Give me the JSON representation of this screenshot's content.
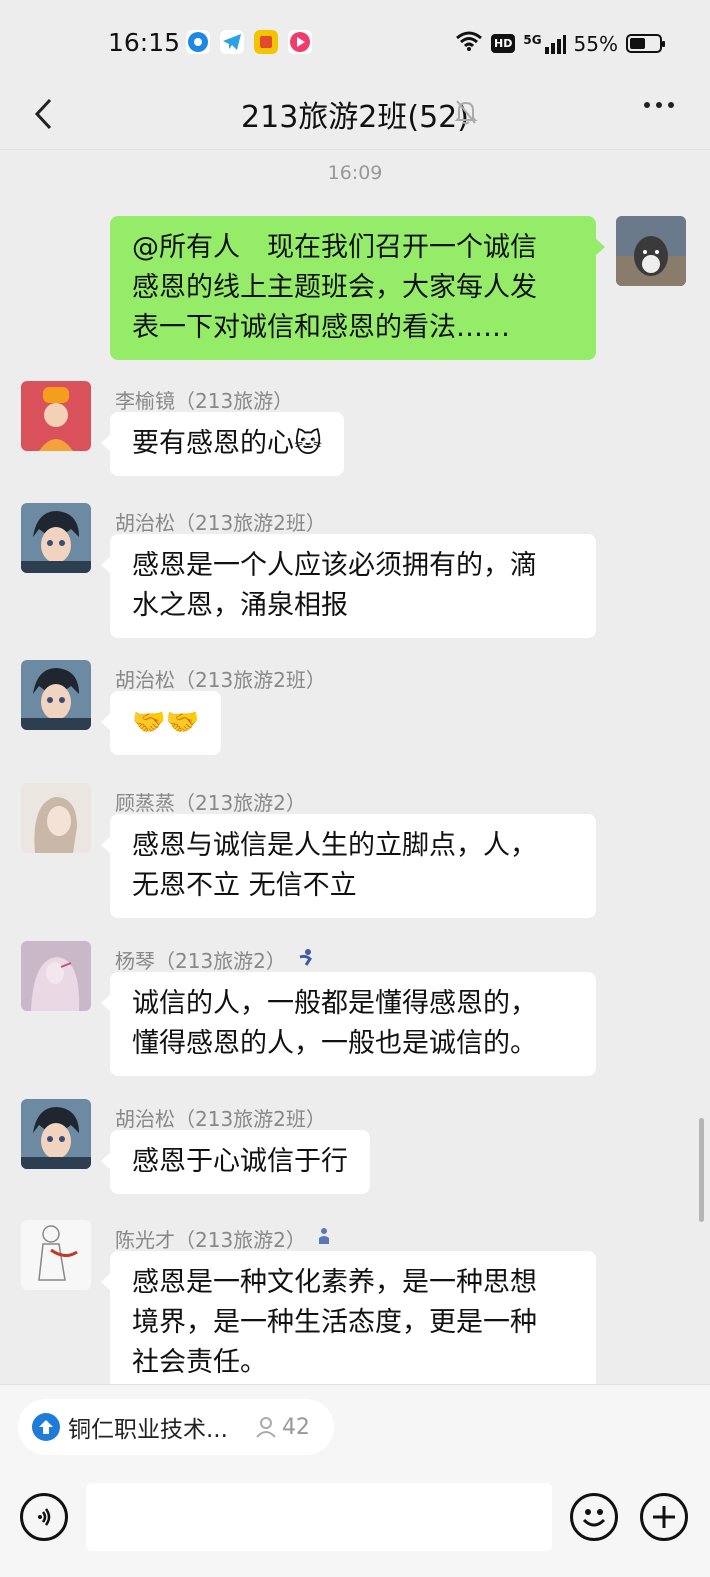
{
  "status_bar": {
    "time": "16:15",
    "battery": "55%",
    "battery_level": 0.55,
    "network": "5G",
    "hd": "HD",
    "app_icons": [
      "browser-icon",
      "telegram-icon",
      "puzzle-app-icon",
      "video-app-icon"
    ]
  },
  "header": {
    "title": "213旅游2班(52)",
    "muted": true
  },
  "chat": {
    "timestamp": "16:09",
    "messages": [
      {
        "self": true,
        "text_lines": [
          "@所有人　现在我们召开一个诚信",
          "感恩的线上主题班会，大家每人发",
          "表一下对诚信和感恩的看法……"
        ]
      },
      {
        "sender": "李榆镜（213旅游）",
        "text_lines": [
          "要有感恩的心🐱"
        ]
      },
      {
        "sender": "胡治松（213旅游2班）",
        "text_lines": [
          "感恩是一个人应该必须拥有的，滴",
          "水之恩，涌泉相报"
        ]
      },
      {
        "sender": "胡治松（213旅游2班）",
        "text_lines": [
          "🤝🤝"
        ]
      },
      {
        "sender": "顾蒸蒸（213旅游2）",
        "text_lines": [
          "感恩与诚信是人生的立脚点，人，",
          "无恩不立 无信不立"
        ]
      },
      {
        "sender": "杨琴（213旅游2）",
        "text_lines": [
          "诚信的人，一般都是懂得感恩的，",
          "懂得感恩的人，一般也是诚信的。"
        ]
      },
      {
        "sender": "胡治松（213旅游2班）",
        "text_lines": [
          "感恩于心诚信于行"
        ]
      },
      {
        "sender": "陈光才（213旅游2）",
        "text_lines": [
          "感恩是一种文化素养，是一种思想",
          "境界，是一种生活态度，更是一种",
          "社会责任。"
        ]
      }
    ]
  },
  "bottom_bar": {
    "quick_card_label": "铜仁职业技术...",
    "quick_card_count": "42",
    "input_value": ""
  }
}
